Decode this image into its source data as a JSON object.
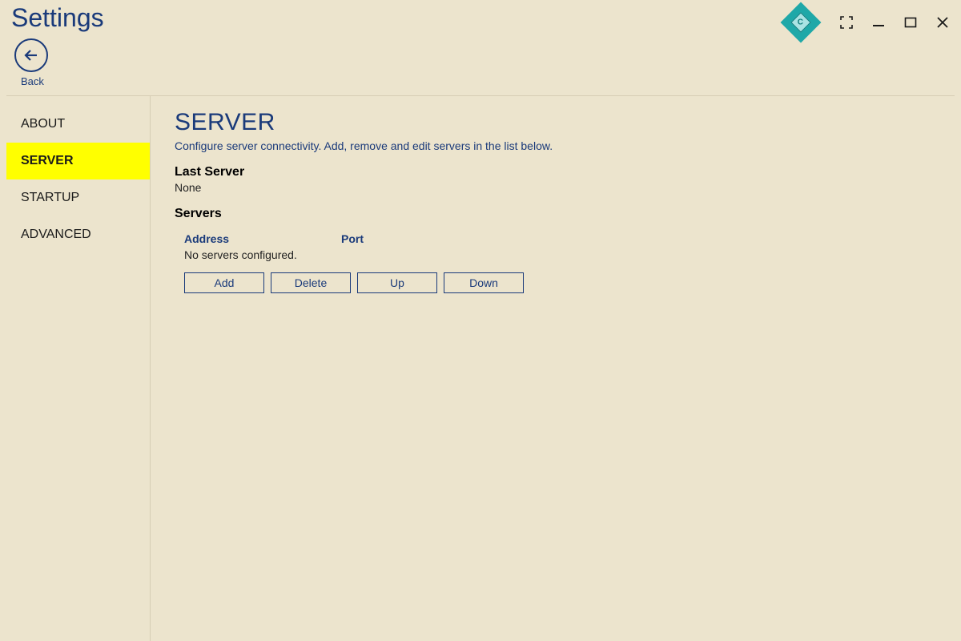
{
  "window": {
    "title": "Settings"
  },
  "back": {
    "label": "Back"
  },
  "sidebar": {
    "items": [
      {
        "label": "ABOUT",
        "active": false
      },
      {
        "label": "SERVER",
        "active": true
      },
      {
        "label": "STARTUP",
        "active": false
      },
      {
        "label": "ADVANCED",
        "active": false
      }
    ]
  },
  "page": {
    "heading": "SERVER",
    "description": "Configure server connectivity. Add, remove and edit servers in the list below.",
    "last_server_label": "Last Server",
    "last_server_value": "None",
    "servers_label": "Servers",
    "table": {
      "col_address": "Address",
      "col_port": "Port",
      "empty": "No servers configured."
    },
    "buttons": {
      "add": "Add",
      "delete": "Delete",
      "up": "Up",
      "down": "Down"
    }
  }
}
